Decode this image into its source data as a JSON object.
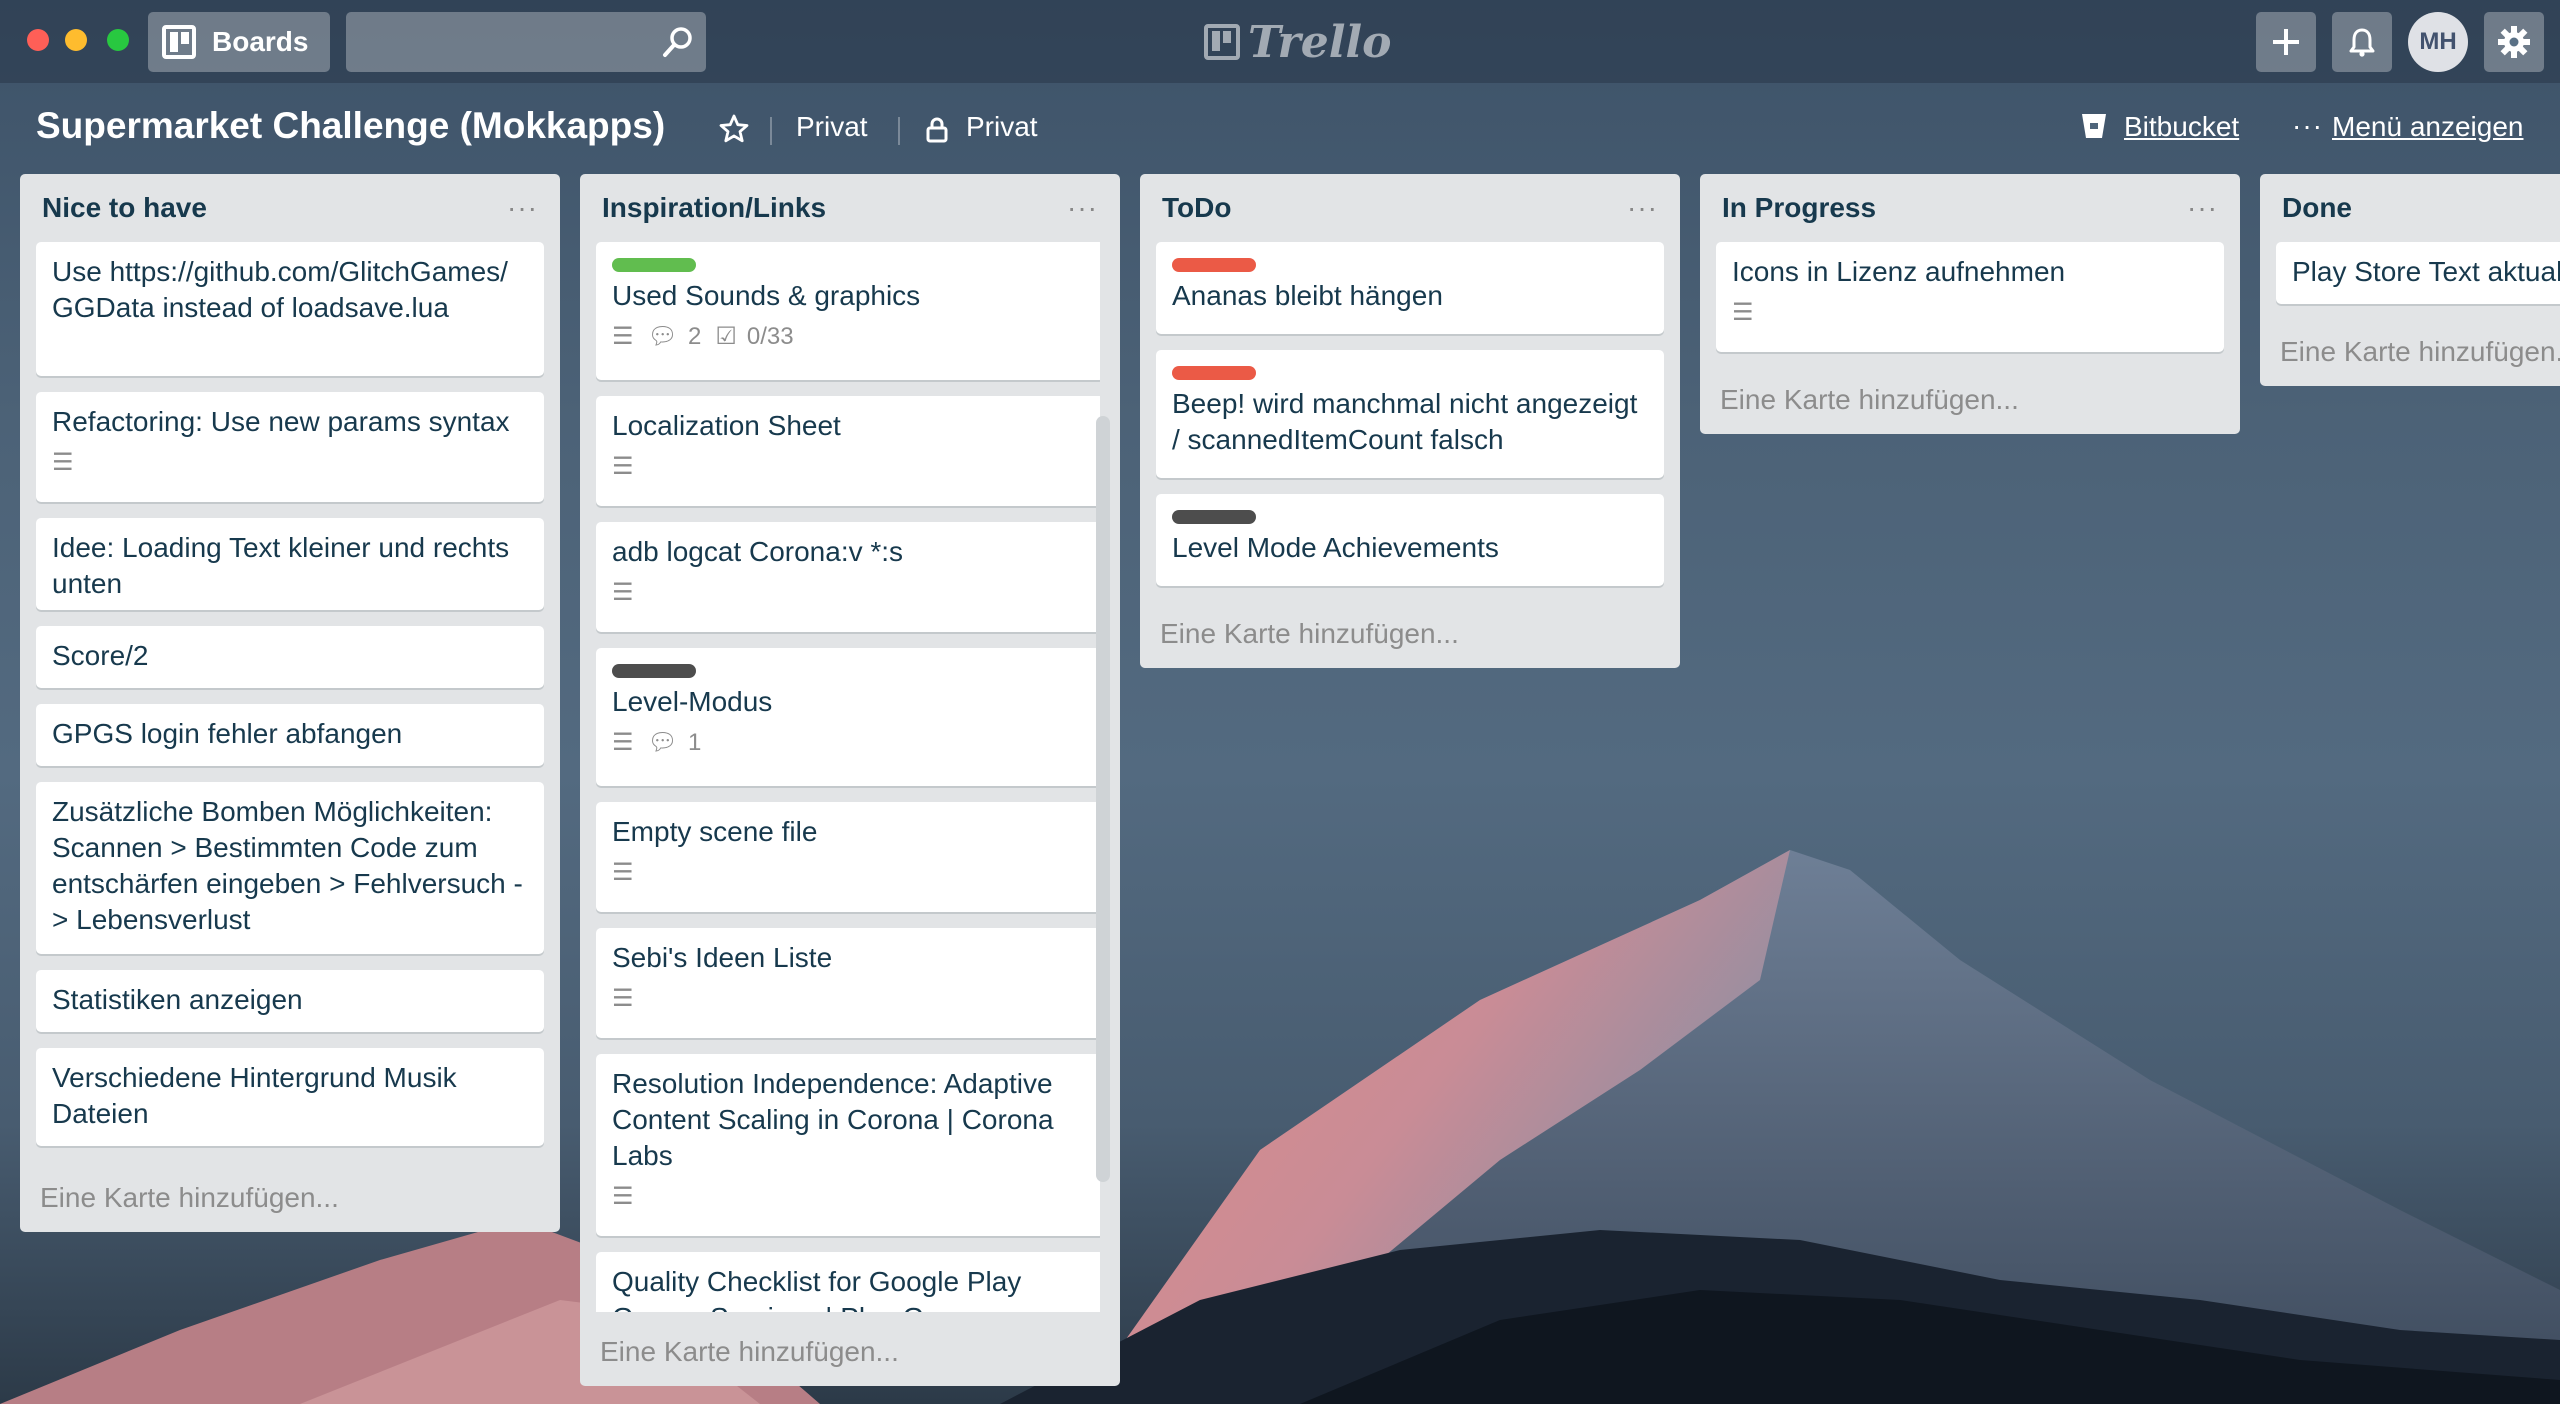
{
  "window": {
    "traffic_lights": [
      "close",
      "minimize",
      "zoom"
    ]
  },
  "topbar": {
    "boards_label": "Boards",
    "search": {
      "value": "",
      "placeholder": ""
    },
    "logo_text": "Trello",
    "avatar_initials": "MH",
    "icons": [
      "boards-icon",
      "search-icon",
      "add-icon",
      "bell-icon",
      "gear-icon"
    ]
  },
  "board": {
    "title": "Supermarket Challenge (Mokkapps)",
    "team_label": "Privat",
    "visibility_label": "Privat",
    "bitbucket_label": "Bitbucket",
    "menu_label": "Menü anzeigen"
  },
  "colors": {
    "label_green": "#61bd4f",
    "label_red": "#eb5a46",
    "label_black": "#4d4d4d",
    "list_bg": "#e2e4e6",
    "title_text": "#17394d"
  },
  "lists": [
    {
      "title": "Nice to have",
      "add_card": "Eine Karte hinzufügen...",
      "cards": [
        {
          "text": "Use https://github.com/GlitchGames/GGData instead of loadsave.lua"
        },
        {
          "text": "Refactoring: Use new params syntax",
          "description": true
        },
        {
          "text": "Idee: Loading Text kleiner und rechts unten"
        },
        {
          "text": "Score/2"
        },
        {
          "text": "GPGS login fehler abfangen"
        },
        {
          "text": "Zusätzliche Bomben Möglichkeiten: Scannen > Bestimmten Code zum entschärfen eingeben > Fehlversuch -> Lebensverlust"
        },
        {
          "text": "Statistiken anzeigen"
        },
        {
          "text": "Verschiedene Hintergrund Musik Dateien"
        }
      ]
    },
    {
      "title": "Inspiration/Links",
      "add_card": "Eine Karte hinzufügen...",
      "cards": [
        {
          "text": "Used Sounds & graphics",
          "label": "green",
          "description": true,
          "comments": "2",
          "checklist": "0/33"
        },
        {
          "text": "Localization Sheet",
          "description": true
        },
        {
          "text": "adb logcat Corona:v *:s",
          "description": true
        },
        {
          "text": "Level-Modus",
          "label": "black",
          "description": true,
          "comments": "1"
        },
        {
          "text": "Empty scene file",
          "description": true
        },
        {
          "text": "Sebi's Ideen Liste",
          "description": true
        },
        {
          "text": "Resolution Independence: Adaptive Content Scaling in Corona | Corona Labs",
          "description": true
        },
        {
          "text": "Quality Checklist for Google Play Games Services | Play Games"
        }
      ]
    },
    {
      "title": "ToDo",
      "add_card": "Eine Karte hinzufügen...",
      "cards": [
        {
          "text": "Ananas bleibt hängen",
          "label": "red"
        },
        {
          "text": "Beep! wird manchmal nicht angezeigt / scannedItemCount falsch",
          "label": "red"
        },
        {
          "text": "Level Mode Achievements",
          "label": "black"
        }
      ]
    },
    {
      "title": "In Progress",
      "add_card": "Eine Karte hinzufügen...",
      "cards": [
        {
          "text": "Icons in Lizenz aufnehmen",
          "description": true
        }
      ]
    },
    {
      "title": "Done",
      "add_card": "Eine Karte hinzufügen...",
      "cards": [
        {
          "text": "Play Store Text aktualisieren"
        }
      ]
    }
  ]
}
